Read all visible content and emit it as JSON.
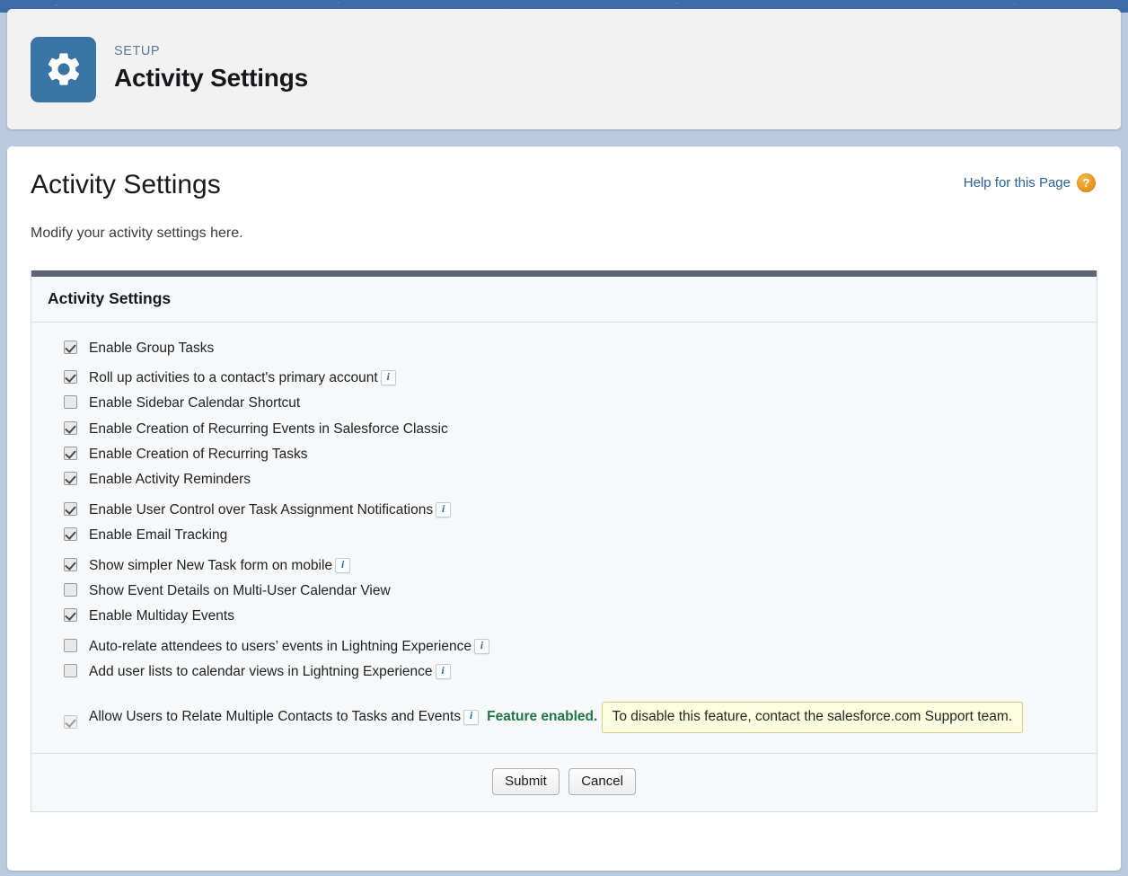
{
  "colors": {
    "brand_blue": "#3e6ca6",
    "page_bg": "#b9cae1",
    "panel_bar": "#5c6478",
    "link": "#2a6099",
    "success_green": "#1d7844",
    "notice_bg": "#fdfddf",
    "notice_border": "#d9c98b"
  },
  "setup_header": {
    "eyebrow": "SETUP",
    "title": "Activity Settings",
    "icon": "gear-icon"
  },
  "page": {
    "title": "Activity Settings",
    "subtitle": "Modify your activity settings here.",
    "help_label": "Help for this Page",
    "help_icon": "question-mark-icon"
  },
  "panel": {
    "header": "Activity Settings",
    "options": [
      {
        "label": "Enable Group Tasks",
        "checked": true,
        "info": false,
        "spacing": "none"
      },
      {
        "label": "Roll up activities to a contact's primary account",
        "checked": true,
        "info": true,
        "spacing": "sp-13"
      },
      {
        "label": "Enable Sidebar Calendar Shortcut",
        "checked": false,
        "info": false,
        "spacing": "sp-8"
      },
      {
        "label": "Enable Creation of Recurring Events in Salesforce Classic",
        "checked": true,
        "info": false,
        "spacing": "sp-8"
      },
      {
        "label": "Enable Creation of Recurring Tasks",
        "checked": true,
        "info": false,
        "spacing": "sp-8"
      },
      {
        "label": "Enable Activity Reminders",
        "checked": true,
        "info": false,
        "spacing": "sp-8"
      },
      {
        "label": "Enable User Control over Task Assignment Notifications",
        "checked": true,
        "info": true,
        "spacing": "sp-13"
      },
      {
        "label": "Enable Email Tracking",
        "checked": true,
        "info": false,
        "spacing": "sp-8"
      },
      {
        "label": "Show simpler New Task form on mobile",
        "checked": true,
        "info": true,
        "spacing": "sp-13"
      },
      {
        "label": "Show Event Details on Multi-User Calendar View",
        "checked": false,
        "info": false,
        "spacing": "sp-8"
      },
      {
        "label": "Enable Multiday Events",
        "checked": true,
        "info": false,
        "spacing": "sp-8"
      },
      {
        "label": "Auto-relate attendees to users’ events in Lightning Experience",
        "checked": false,
        "info": true,
        "spacing": "sp-13"
      },
      {
        "label": "Add user lists to calendar views in Lightning Experience",
        "checked": false,
        "info": true,
        "spacing": "sp-8"
      }
    ],
    "final_option": {
      "label": "Allow Users to Relate Multiple Contacts to Tasks and Events",
      "checked": true,
      "faded": true,
      "info": true,
      "status": "Feature enabled.",
      "notice": "To disable this feature, contact the salesforce.com Support team."
    },
    "footer": {
      "submit_label": "Submit",
      "cancel_label": "Cancel"
    }
  }
}
